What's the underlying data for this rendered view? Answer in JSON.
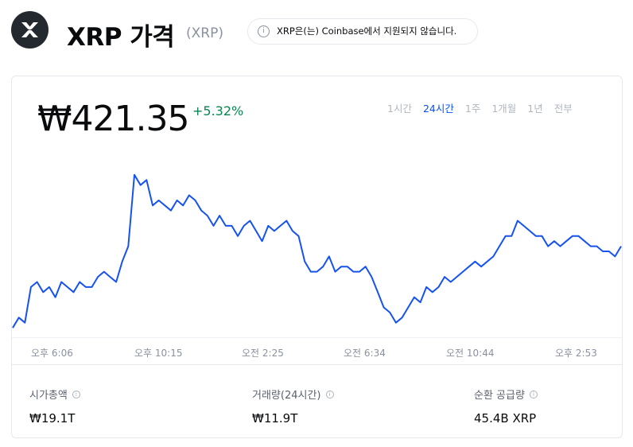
{
  "header": {
    "title": "XRP 가격",
    "ticker": "(XRP)",
    "notice": "XRP은(는) Coinbase에서 지원되지 않습니다.",
    "info_glyph": "i"
  },
  "price": {
    "value": "₩421.35",
    "change": "+5.32%"
  },
  "ranges": [
    {
      "label": "1시간",
      "active": false
    },
    {
      "label": "24시간",
      "active": true
    },
    {
      "label": "1주",
      "active": false
    },
    {
      "label": "1개월",
      "active": false
    },
    {
      "label": "1년",
      "active": false
    },
    {
      "label": "전부",
      "active": false
    }
  ],
  "colors": {
    "line": "#1652f0",
    "positive": "#098551",
    "active_range": "#0052ff"
  },
  "chart_data": {
    "type": "line",
    "x": [
      "오후 6:06",
      "오후 10:15",
      "오전 2:25",
      "오전 6:34",
      "오전 10:44",
      "오후 2:53"
    ],
    "values": [
      398,
      400,
      399,
      406,
      407,
      405,
      406,
      404,
      407,
      406,
      405,
      407,
      406,
      406,
      408,
      409,
      408,
      407,
      411,
      414,
      428,
      426,
      427,
      422,
      423,
      422,
      421,
      423,
      422,
      424,
      423,
      421,
      420,
      418,
      420,
      418,
      418,
      416,
      418,
      419,
      417,
      415,
      418,
      417,
      418,
      419,
      417,
      416,
      411,
      409,
      409,
      410,
      412,
      409,
      410,
      410,
      409,
      409,
      410,
      408,
      405,
      402,
      401,
      399,
      400,
      402,
      404,
      403,
      406,
      405,
      406,
      408,
      407,
      408,
      409,
      410,
      411,
      410,
      411,
      412,
      414,
      416,
      416,
      419,
      418,
      417,
      416,
      416,
      414,
      415,
      414,
      415,
      416,
      416,
      415,
      414,
      414,
      413,
      413,
      412,
      414
    ],
    "grid": false,
    "legend": "none"
  },
  "stats": [
    {
      "label": "시가총액",
      "value": "₩19.1T"
    },
    {
      "label": "거래량(24시간)",
      "value": "₩11.9T"
    },
    {
      "label": "순환 공급량",
      "value": "45.4B XRP"
    }
  ]
}
